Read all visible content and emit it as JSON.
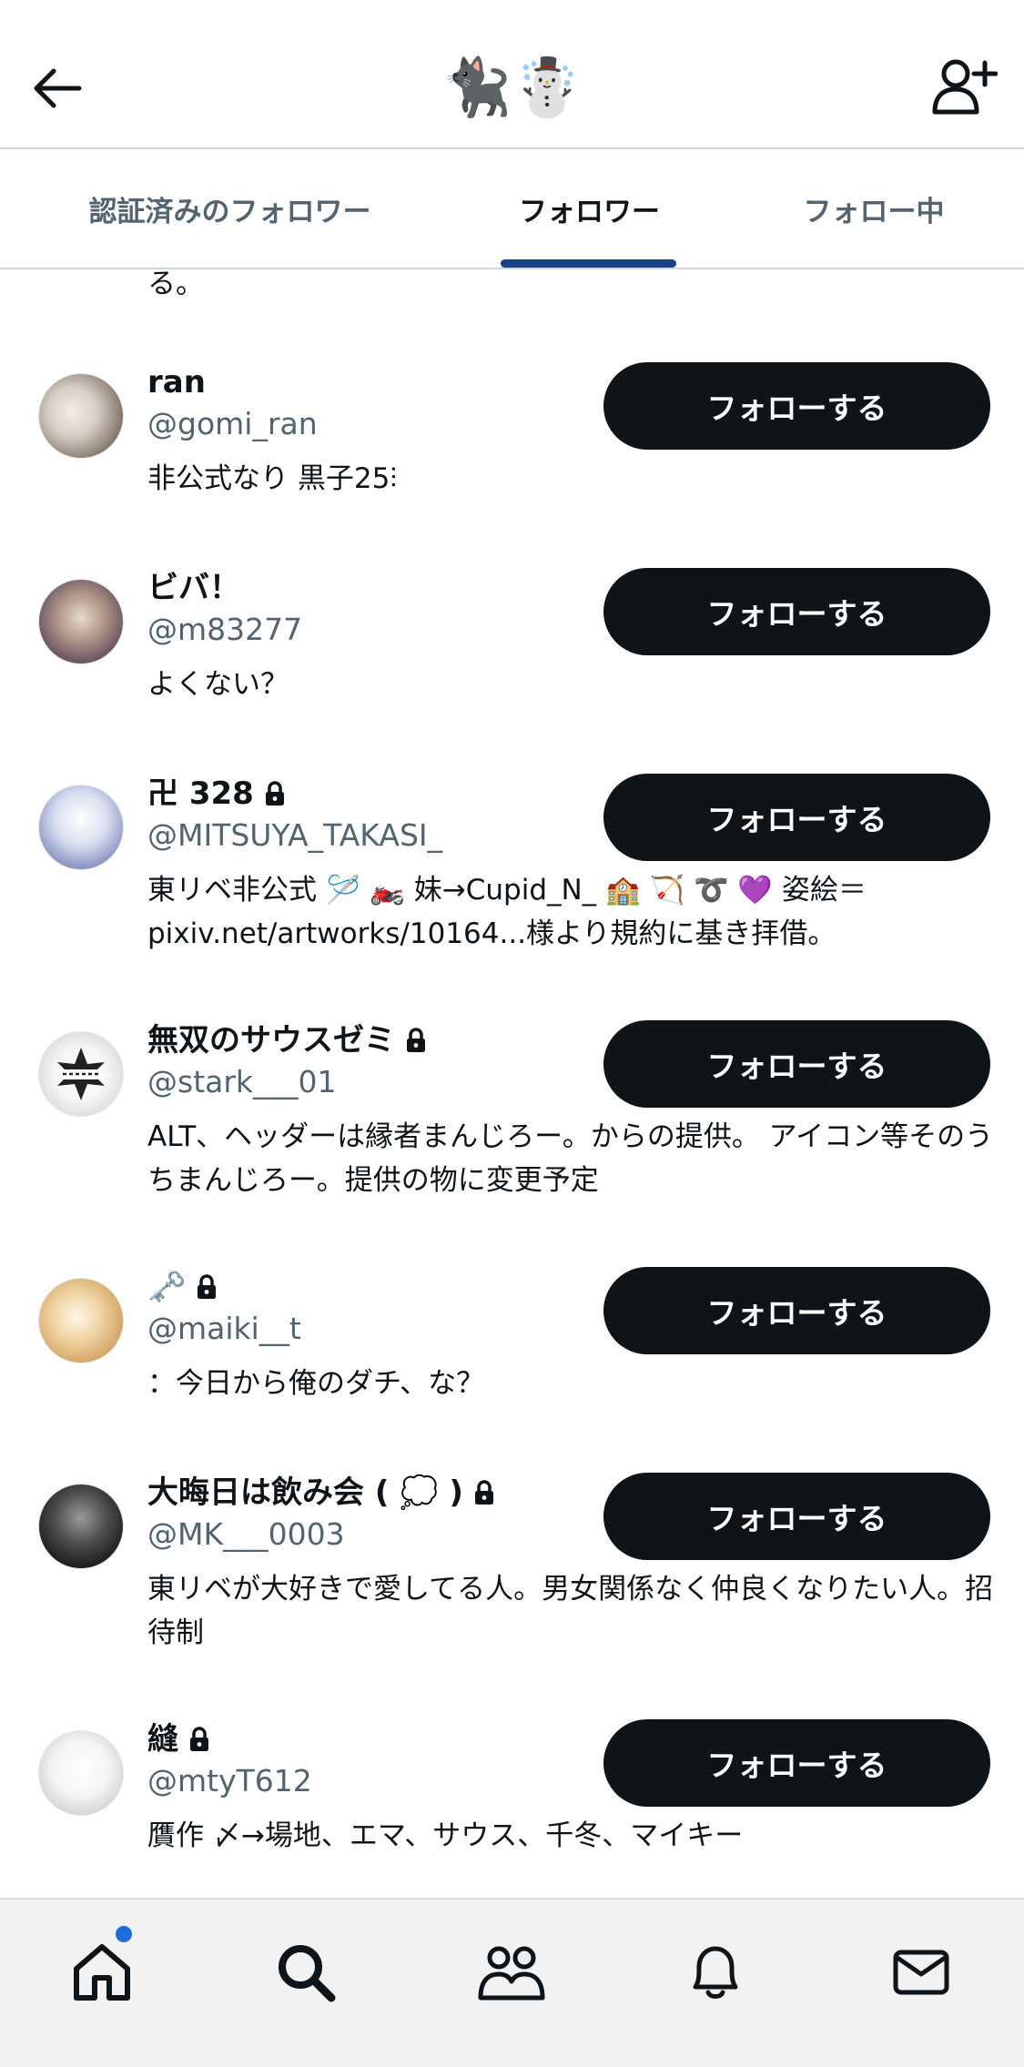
{
  "header": {
    "title": "🐈‍⬛☃️"
  },
  "tabs": [
    {
      "label": "認証済みのフォロワー",
      "active": false
    },
    {
      "label": "フォロワー",
      "active": true
    },
    {
      "label": "フォロー中",
      "active": false
    }
  ],
  "cut_bio": "る。",
  "follow_label": "フォローする",
  "users": [
    {
      "name": "ran",
      "handle": "@gomi_ran",
      "bio": "非公式なり 黒子25⫶",
      "locked": false
    },
    {
      "name": "ビバ！",
      "handle": "@m83277",
      "bio": "よくない？",
      "locked": false
    },
    {
      "name": "卍 328",
      "handle": "@MITSUYA_TAKASI_",
      "bio": "東リベ非公式 🪡 🏍️ 妹→Cupid_N_ 🏫 🏹 ➰ 💜 姿絵＝pixiv.net/artworks/10164...様より規約に基き拝借。",
      "locked": true
    },
    {
      "name": "無双のサウスゼミ",
      "handle": "@stark___01",
      "bio": "ALT、ヘッダーは縁者まんじろー。からの提供。 アイコン等そのうちまんじろー。提供の物に変更予定",
      "locked": true
    },
    {
      "name": "🗝️",
      "handle": "@maiki__t",
      "bio": "：今日から俺のダチ、な？",
      "locked": true
    },
    {
      "name": "大晦日は飲み会 ( 💭 )",
      "handle": "@MK___0003",
      "bio": "東リベが大好きで愛してる人。男女関係なく仲良くなりたい人。招待制",
      "locked": true
    },
    {
      "name": "縫",
      "handle": "@mtyT612",
      "bio": "贋作 〆→場地、エマ、サウス、千冬、マイキー",
      "locked": true
    }
  ],
  "bottom_nav": [
    "home-icon",
    "search-icon",
    "communities-icon",
    "notifications-icon",
    "messages-icon"
  ],
  "colors": {
    "button": "#0f1419",
    "tab_indicator": "#1d3f8f",
    "notification_dot": "#1d6fd8"
  }
}
